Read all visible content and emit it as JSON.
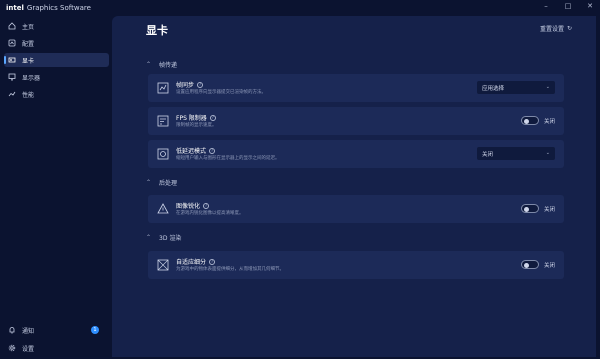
{
  "app": {
    "brand": "intel",
    "title": "Graphics Software"
  },
  "window_controls": {
    "minimize": "–",
    "maximize": "□",
    "close": "✕"
  },
  "sidebar": {
    "items": [
      {
        "label": "主页",
        "icon": "home-icon"
      },
      {
        "label": "配置",
        "icon": "gauge-icon"
      },
      {
        "label": "显卡",
        "icon": "gpu-icon"
      },
      {
        "label": "显示器",
        "icon": "monitor-icon"
      },
      {
        "label": "性能",
        "icon": "chart-icon"
      }
    ],
    "bottom": [
      {
        "label": "通知",
        "icon": "bell-icon",
        "badge": "1"
      },
      {
        "label": "设置",
        "icon": "gear-icon"
      }
    ]
  },
  "main": {
    "title": "显卡",
    "reset_label": "重置设置",
    "sections": [
      {
        "label": "帧传递",
        "cards": [
          {
            "title": "帧同步",
            "desc": "设置应用程序向显示器提交已渲染帧的方法。",
            "control": "select",
            "value": "应用选择"
          },
          {
            "title": "FPS 限制器",
            "desc": "限制帧的显示速度。",
            "control": "toggle",
            "value": "关闭"
          },
          {
            "title": "低延迟模式",
            "desc": "缩短用户输入与图形在显示器上的显示之间的延迟。",
            "control": "select",
            "value": "关闭"
          }
        ]
      },
      {
        "label": "后处理",
        "cards": [
          {
            "title": "图像锐化",
            "desc": "在游戏内锐化图像以提高清晰度。",
            "control": "toggle",
            "value": "关闭"
          }
        ]
      },
      {
        "label": "3D 渲染",
        "cards": [
          {
            "title": "自适应细分",
            "desc": "为游戏中的物体表面提供细分，从而增加其几何细节。",
            "control": "toggle",
            "value": "关闭"
          }
        ]
      }
    ]
  },
  "colors": {
    "accent": "#2f8fff",
    "background": "#0b1330",
    "panel": "#15214a",
    "card": "#1c2a58"
  }
}
